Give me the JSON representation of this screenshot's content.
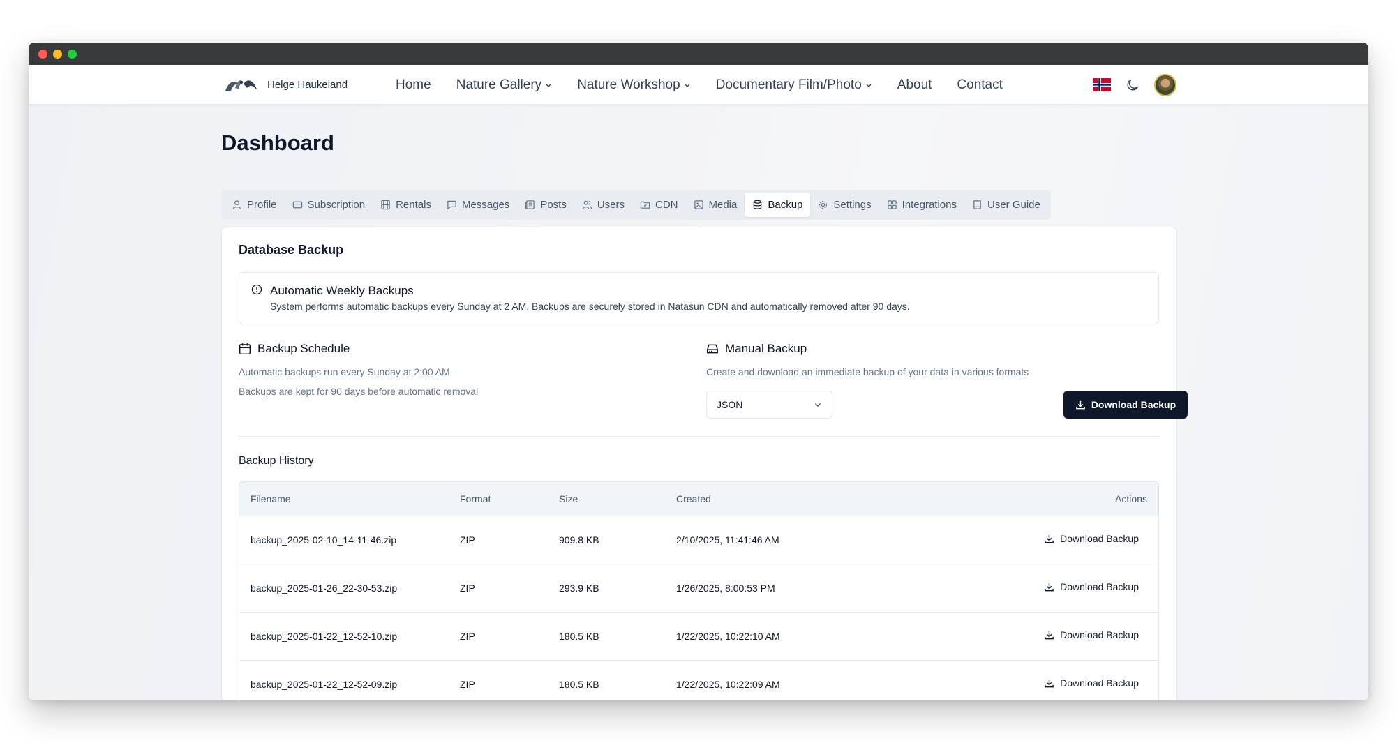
{
  "brand": {
    "name": "Helge Haukeland"
  },
  "nav": {
    "links": [
      {
        "label": "Home"
      },
      {
        "label": "Nature Gallery"
      },
      {
        "label": "Nature Workshop"
      },
      {
        "label": "Documentary Film/Photo"
      },
      {
        "label": "About"
      },
      {
        "label": "Contact"
      }
    ],
    "flag": "norway-flag-icon",
    "theme_toggle": "moon-icon"
  },
  "page": {
    "title": "Dashboard"
  },
  "tabs": [
    {
      "label": "Profile",
      "icon": "user-icon"
    },
    {
      "label": "Subscription",
      "icon": "credit-card-icon"
    },
    {
      "label": "Rentals",
      "icon": "film-icon"
    },
    {
      "label": "Messages",
      "icon": "message-icon"
    },
    {
      "label": "Posts",
      "icon": "newspaper-icon"
    },
    {
      "label": "Users",
      "icon": "users-icon"
    },
    {
      "label": "CDN",
      "icon": "folder-icon"
    },
    {
      "label": "Media",
      "icon": "image-icon"
    },
    {
      "label": "Backup",
      "icon": "database-icon",
      "active": true
    },
    {
      "label": "Settings",
      "icon": "gear-icon"
    },
    {
      "label": "Integrations",
      "icon": "grid-icon"
    },
    {
      "label": "User Guide",
      "icon": "book-icon"
    }
  ],
  "backup": {
    "title": "Database Backup",
    "alert": {
      "title": "Automatic Weekly Backups",
      "description": "System performs automatic backups every Sunday at 2 AM. Backups are securely stored in Natasun CDN and automatically removed after 90 days."
    },
    "schedule": {
      "title": "Backup Schedule",
      "line1": "Automatic backups run every Sunday at 2:00 AM",
      "line2": "Backups are kept for 90 days before automatic removal"
    },
    "manual": {
      "title": "Manual Backup",
      "description": "Create and download an immediate backup of your data in various formats",
      "format_selected": "JSON",
      "button_label": "Download Backup"
    },
    "history": {
      "title": "Backup History",
      "columns": [
        "Filename",
        "Format",
        "Size",
        "Created",
        "Actions"
      ],
      "rows": [
        {
          "filename": "backup_2025-02-10_14-11-46.zip",
          "format": "ZIP",
          "size": "909.8 KB",
          "created": "2/10/2025, 11:41:46 AM",
          "action": "Download Backup"
        },
        {
          "filename": "backup_2025-01-26_22-30-53.zip",
          "format": "ZIP",
          "size": "293.9 KB",
          "created": "1/26/2025, 8:00:53 PM",
          "action": "Download Backup"
        },
        {
          "filename": "backup_2025-01-22_12-52-10.zip",
          "format": "ZIP",
          "size": "180.5 KB",
          "created": "1/22/2025, 10:22:10 AM",
          "action": "Download Backup"
        },
        {
          "filename": "backup_2025-01-22_12-52-09.zip",
          "format": "ZIP",
          "size": "180.5 KB",
          "created": "1/22/2025, 10:22:09 AM",
          "action": "Download Backup"
        }
      ]
    }
  },
  "colors": {
    "primary": "#0f172a",
    "muted_text": "#64748b",
    "border": "#e2e8f0",
    "tab_bar_bg": "#e9edf2",
    "titlebar": "#393a3c",
    "window_close": "#ff5f57",
    "window_minimize": "#febc2e",
    "window_zoom": "#28c840"
  }
}
